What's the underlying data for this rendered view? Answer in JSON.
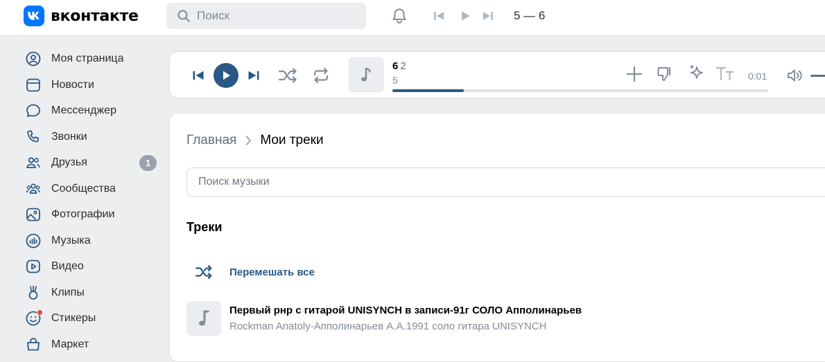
{
  "header": {
    "logo_text": "вконтакте",
    "search_placeholder": "Поиск",
    "now_playing_title": "5 — 6"
  },
  "sidebar": {
    "items": [
      {
        "label": "Моя страница",
        "icon": "user-circle-icon"
      },
      {
        "label": "Новости",
        "icon": "newsfeed-icon"
      },
      {
        "label": "Мессенджер",
        "icon": "message-icon"
      },
      {
        "label": "Звонки",
        "icon": "phone-icon"
      },
      {
        "label": "Друзья",
        "icon": "friends-icon",
        "badge": "1"
      },
      {
        "label": "Сообщества",
        "icon": "communities-icon"
      },
      {
        "label": "Фотографии",
        "icon": "photo-icon"
      },
      {
        "label": "Музыка",
        "icon": "music-icon"
      },
      {
        "label": "Видео",
        "icon": "video-icon"
      },
      {
        "label": "Клипы",
        "icon": "clips-icon"
      },
      {
        "label": "Стикеры",
        "icon": "stickers-icon"
      },
      {
        "label": "Маркет",
        "icon": "market-icon"
      }
    ]
  },
  "player": {
    "title_main": "6",
    "title_secondary": "2",
    "artist": "5",
    "time": "0:01",
    "progress": 0.19
  },
  "content": {
    "breadcrumb_home": "Главная",
    "breadcrumb_current": "Мои треки",
    "search_placeholder": "Поиск музыки",
    "section_title": "Треки",
    "shuffle_all_label": "Перемешать все",
    "tracks": [
      {
        "title": "Первый рнр с гитарой UNISYNCH в записи-91г СОЛО Апполинарьев",
        "artist": "Rockman Anatoly-Апполинарьев А.А.1991 соло гитара UNISYNCH"
      }
    ]
  },
  "colors": {
    "brand": "#0077ff",
    "accent": "#2a5885",
    "badge": "#99a2ad",
    "notification_dot": "#e64646"
  }
}
